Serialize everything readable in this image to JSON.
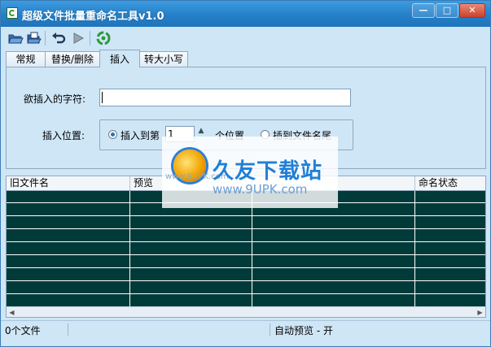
{
  "window": {
    "title": "超级文件批量重命名工具v1.0",
    "controls": [
      "—",
      "□",
      "✕"
    ]
  },
  "toolbar": {
    "buttons": [
      "open-folder-icon",
      "open-files-icon",
      "undo-icon",
      "run-icon",
      "recycle-icon"
    ]
  },
  "tabs": [
    {
      "label": "常规",
      "active": false
    },
    {
      "label": "替换/删除",
      "active": false
    },
    {
      "label": "插入",
      "active": true
    },
    {
      "label": "转大小写",
      "active": false
    }
  ],
  "insert_panel": {
    "insert_text_label": "欲插入的字符:",
    "insert_text_value": "",
    "position_label": "插入位置:",
    "option_position_prefix": "插入到第",
    "position_value": "1",
    "option_position_suffix": "个位置",
    "option_end_label": "插到文件名尾",
    "selected": "position"
  },
  "grid": {
    "columns": [
      "旧文件名",
      "预览",
      "",
      "命名状态"
    ],
    "rows": []
  },
  "status": {
    "file_count": "0个文件",
    "preview_state": "自动预览 - 开"
  },
  "watermark": {
    "title": "久友下载站",
    "url": "www.9UPK.com",
    "faint": "www.9UPK.com"
  },
  "colors": {
    "title_bar": "#2580c8",
    "body_bg": "#cfe6f6",
    "grid_bg": "#003b3a"
  }
}
